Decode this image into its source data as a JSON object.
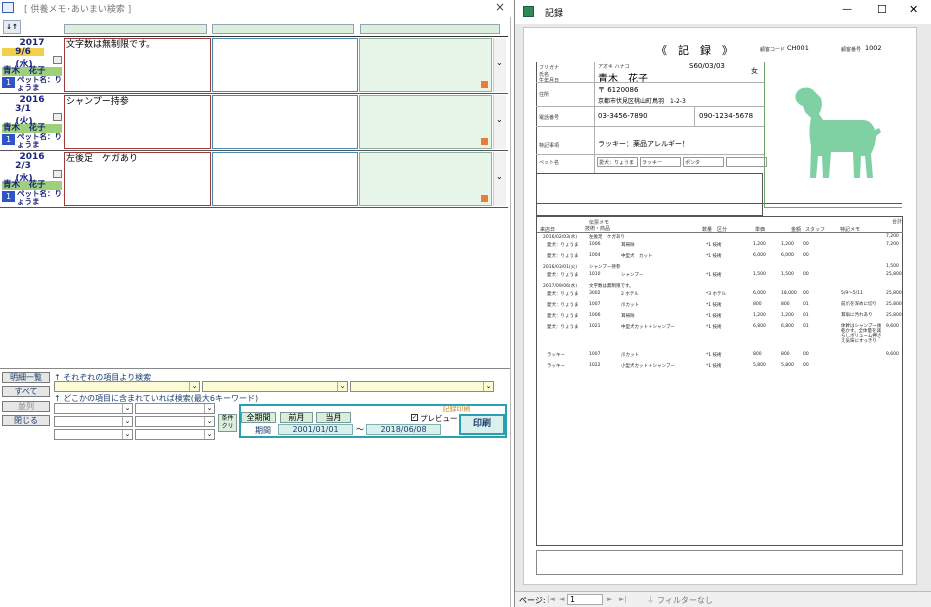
{
  "left_window": {
    "title": "[ 供養メモ･あいまい検索 ]",
    "close_glyph": "×",
    "sort_button": "↓↑",
    "records": [
      {
        "year": "2017",
        "date": "9/6",
        "weekday": "(水)",
        "customer": "青木　花子",
        "count": "1",
        "pet": "ペット名：りょうま",
        "note": "文字数は無制限です。"
      },
      {
        "year": "2016",
        "date": "3/1",
        "weekday": "(火)",
        "customer": "青木　花子",
        "count": "1",
        "pet": "ペット名：りょうま",
        "note": "シャンプー持参"
      },
      {
        "year": "2016",
        "date": "2/3",
        "weekday": "(水)",
        "customer": "青木　花子",
        "count": "1",
        "pet": "ペット名：りょうま",
        "note": "左後足　ケガあり"
      }
    ],
    "buttons": {
      "list": "明細一覧",
      "all": "すべて",
      "sort": "並列",
      "close": "閉じる",
      "clear": "条件クリア",
      "all_period": "全期間",
      "prev_month": "前月",
      "this_month": "当月",
      "print": "印刷",
      "print_memo": "記録印刷"
    },
    "labels": {
      "per_item": "↑ それぞれの項目より検索",
      "any_item": "↑ どこかの項目に含まれていれば検索(最大6キーワード)",
      "period": "期間",
      "preview": "プレビュー",
      "tilde": "～"
    },
    "period": {
      "from": "2001/01/01",
      "to": "2018/06/08"
    }
  },
  "right_window": {
    "title": "記録",
    "controls": {
      "min": "—",
      "max": "☐",
      "close": "✕"
    },
    "report": {
      "heading": "《　記　録　》",
      "customer_code_label": "顧客コード",
      "customer_code": "CH001",
      "record_no_label": "顧客番号",
      "record_no": "1002",
      "furigana_label": "フリガナ",
      "name_label": "氏名",
      "birth_label": "生年月日",
      "furigana": "アオキ ハナコ",
      "name": "青木　花子",
      "birthdate": "S60/03/03",
      "gender": "女",
      "address_label": "住所",
      "postal": "〒 6120086",
      "address": "京都市伏見区桃山町鳥羽　1-2-3",
      "phone_label": "電話番号",
      "phone1": "03-3456-7890",
      "phone2": "090-1234-5678",
      "special_label": "特記事項",
      "special": "ラッキー：薬品アレルギー！",
      "pet_label": "ペット名",
      "pets": [
        "愛犬：りょうま",
        "ラッキー",
        "ポンタ",
        ""
      ],
      "table_headers": [
        "来店日",
        "伝票メモ",
        "技術・商品",
        "数量",
        "区分",
        "単価",
        "金額",
        "スタッフ",
        "特記メモ",
        "合計"
      ],
      "rows": [
        {
          "date": "2016/02/03(水)",
          "memo": "左後足　ケガあり",
          "amount": "7,200"
        },
        {
          "pet": "愛犬：りょうま",
          "code": "1006",
          "item": "耳掃除",
          "qty": "1",
          "kbn": "*1 技術",
          "price": "1,200",
          "total": "1,200",
          "staff": "00",
          "note": "",
          "sum": "7,200"
        },
        {
          "pet": "愛犬：りょうま",
          "code": "1004",
          "item": "中型犬　カット",
          "qty": "1",
          "kbn": "*1 技術",
          "price": "6,000",
          "total": "6,000",
          "staff": "00",
          "note": "",
          "sum": ""
        },
        {
          "date": "2016/03/01(火)",
          "memo": "シャンプー持参",
          "amount": "1,500"
        },
        {
          "pet": "愛犬：りょうま",
          "code": "1010",
          "item": "シャンプー",
          "qty": "1",
          "kbn": "*1 技術",
          "price": "1,500",
          "total": "1,500",
          "staff": "00",
          "note": "",
          "sum": "25,800"
        },
        {
          "date": "2017/09/06(水)",
          "memo": "文字数は無制限です。",
          "amount": ""
        },
        {
          "pet": "愛犬：りょうま",
          "code": "3002",
          "item": "2 ホテル",
          "qty": "2",
          "kbn": "*3 ホテル",
          "price": "6,000",
          "total": "18,000",
          "staff": "00",
          "note": "5/9～5/11",
          "sum": "25,800"
        },
        {
          "pet": "愛犬：りょうま",
          "code": "1007",
          "item": "爪カット",
          "qty": "1",
          "kbn": "*1 技術",
          "price": "800",
          "total": "800",
          "staff": "01",
          "note": "前爪を深めに切り",
          "sum": "25,800"
        },
        {
          "pet": "愛犬：りょうま",
          "code": "1006",
          "item": "耳掃除",
          "qty": "1",
          "kbn": "*1 技術",
          "price": "1,200",
          "total": "1,200",
          "staff": "01",
          "note": "耳垢に汚れあり",
          "sum": "25,800"
        },
        {
          "pet": "愛犬：りょうま",
          "code": "1021",
          "item": "中型犬カット＋シャンプー",
          "qty": "1",
          "kbn": "*1 技術",
          "price": "6,800",
          "total": "6,800",
          "staff": "01",
          "note": "体幹はシャンプー後乾かす。全体量を減らしボリューム押さえ気味にすっきり",
          "sum": "9,600"
        },
        {
          "pet": "ラッキー",
          "code": "1007",
          "item": "爪カット",
          "qty": "1",
          "kbn": "*1 技術",
          "price": "800",
          "total": "800",
          "staff": "00",
          "note": "",
          "sum": "9,600"
        },
        {
          "pet": "ラッキー",
          "code": "1022",
          "item": "小型犬カット＋シャンプー",
          "qty": "1",
          "kbn": "*1 技術",
          "price": "5,800",
          "total": "5,800",
          "staff": "00",
          "note": "",
          "sum": ""
        }
      ]
    },
    "status": {
      "page_label": "ページ:",
      "page": "1",
      "filter": "フィルターなし",
      "nav_first": "|◄",
      "nav_prev": "◄",
      "nav_next": "►",
      "nav_last": "►|"
    }
  },
  "colors": {
    "accent_teal": "#2a9fb0",
    "green_fill": "#c9e6a8",
    "yellow_date": "#f2d14a",
    "dog_silhouette": "#7fd1a4",
    "memo_red": "#b23b3b"
  }
}
